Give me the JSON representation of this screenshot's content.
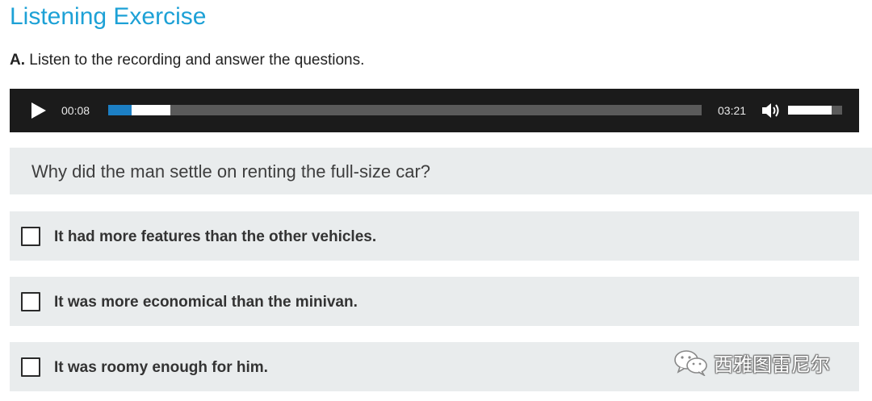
{
  "page": {
    "title": "Listening Exercise"
  },
  "instruction": {
    "section_letter": "A.",
    "text": " Listen to the recording and answer the questions."
  },
  "player": {
    "current_time": "00:08",
    "total_time": "03:21",
    "played_fraction": 0.04,
    "buffered_fraction": 0.105,
    "volume_fraction": 0.8,
    "accent_color": "#1c7fc4",
    "icons": [
      "play-icon",
      "volume-icon"
    ]
  },
  "question": {
    "text": "Why did the man settle on renting the full-size car?"
  },
  "options": [
    {
      "label": "It had more features than the other vehicles.",
      "checked": false
    },
    {
      "label": "It was more economical than the minivan.",
      "checked": false
    },
    {
      "label": "It was roomy enough for him.",
      "checked": false
    }
  ],
  "watermark": {
    "text": "西雅图雷尼尔",
    "icon": "wechat-icon"
  },
  "colors": {
    "title": "#1da1d6",
    "player_bg": "#1b1b1b",
    "panel_bg": "#e9eced"
  }
}
